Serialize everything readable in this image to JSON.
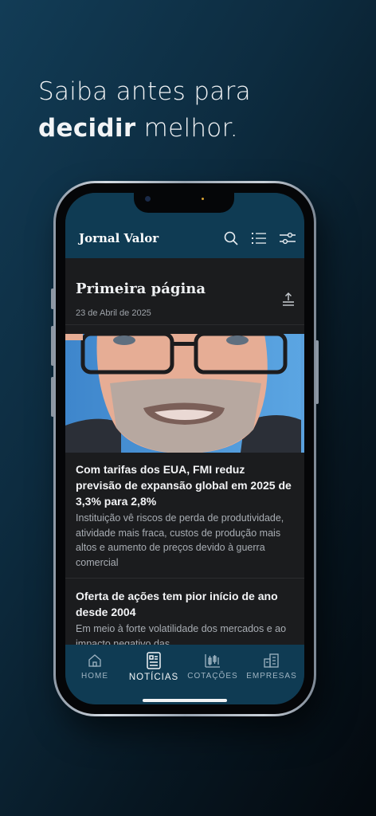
{
  "promo": {
    "line1": "Saiba antes para",
    "line2_bold": "decidir",
    "line2_rest": " melhor."
  },
  "app": {
    "brand": "Jornal Valor",
    "icons": [
      "search-icon",
      "list-icon",
      "filter-icon"
    ]
  },
  "section": {
    "title": "Primeira página",
    "date": "23 de Abril de 2025"
  },
  "articles": [
    {
      "title": "Com tarifas dos EUA, FMI reduz previsão de expansão global em 2025 de 3,3% para 2,8%",
      "subtitle": "Instituição vê riscos de perda de produtividade, atividade mais fraca, custos de produção mais altos e aumento de preços devido à guerra comercial"
    },
    {
      "title": "Oferta de ações tem pior início de ano desde 2004",
      "subtitle": "Em meio à forte volatilidade dos mercados e ao impacto negativo das"
    }
  ],
  "tabs": [
    {
      "label": "HOME",
      "icon": "home-icon"
    },
    {
      "label": "NOTÍCIAS",
      "icon": "news-icon",
      "active": true
    },
    {
      "label": "COTAÇÕES",
      "icon": "chart-icon"
    },
    {
      "label": "EMPRESAS",
      "icon": "buildings-icon"
    }
  ],
  "colors": {
    "appbar": "#0f3b53",
    "screen_bg": "#1b1c1e"
  }
}
